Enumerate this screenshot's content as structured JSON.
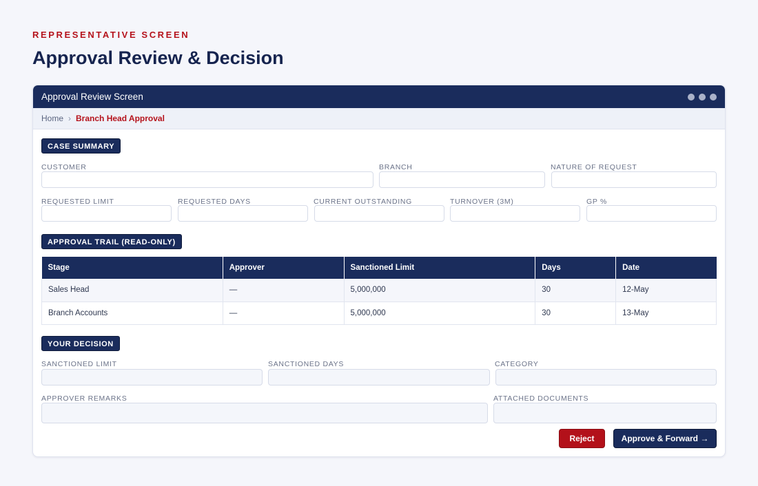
{
  "page": {
    "eyebrow": "REPRESENTATIVE SCREEN",
    "title": "Approval Review & Decision"
  },
  "window": {
    "title": "Approval Review Screen"
  },
  "breadcrumb": {
    "home": "Home",
    "separator": "›",
    "current": "Branch Head Approval"
  },
  "case_summary": {
    "tag": "CASE SUMMARY",
    "fields": {
      "customer": "CUSTOMER",
      "branch": "BRANCH",
      "nature": "NATURE OF REQUEST",
      "requested_limit": "REQUESTED LIMIT",
      "requested_days": "REQUESTED DAYS",
      "current_outstanding": "CURRENT OUTSTANDING",
      "turnover": "TURNOVER (3M)",
      "gp": "GP %"
    }
  },
  "approval_trail": {
    "tag": "APPROVAL TRAIL (READ-ONLY)",
    "columns": [
      "Stage",
      "Approver",
      "Sanctioned Limit",
      "Days",
      "Date"
    ],
    "rows": [
      [
        "Sales Head",
        "—",
        "5,000,000",
        "30",
        "12-May"
      ],
      [
        "Branch Accounts",
        "—",
        "5,000,000",
        "30",
        "13-May"
      ]
    ]
  },
  "decision": {
    "tag": "YOUR DECISION",
    "fields": {
      "sanctioned_limit": "SANCTIONED LIMIT",
      "sanctioned_days": "SANCTIONED DAYS",
      "category": "CATEGORY",
      "remarks": "APPROVER REMARKS",
      "documents": "ATTACHED DOCUMENTS"
    },
    "reject_label": "Reject",
    "approve_label": "Approve & Forward →"
  },
  "colors": {
    "navy": "#1a2c5c",
    "accent_red": "#b5121b",
    "background": "#f5f6fb"
  }
}
